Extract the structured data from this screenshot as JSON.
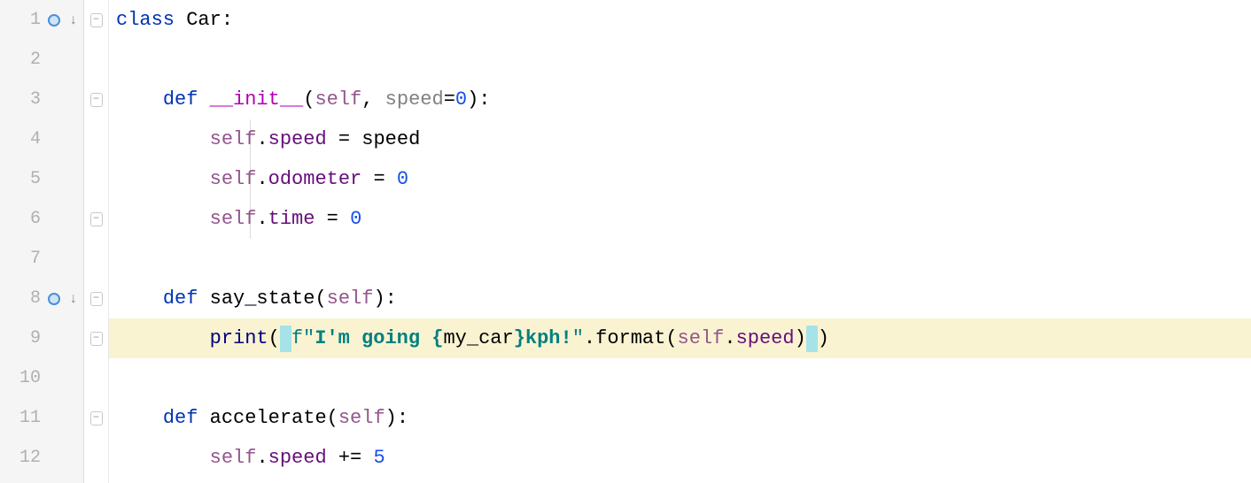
{
  "lines": [
    "1",
    "2",
    "3",
    "4",
    "5",
    "6",
    "7",
    "8",
    "9",
    "10",
    "11",
    "12"
  ],
  "code": {
    "l1": {
      "kw": "class",
      "name": "Car",
      "colon": ":"
    },
    "l3": {
      "kw": "def",
      "name": "__init__",
      "lp": "(",
      "self": "self",
      "comma": ", ",
      "param": "speed",
      "eq": "=",
      "default": "0",
      "rp": ")",
      "colon": ":"
    },
    "l4": {
      "self": "self",
      "dot": ".",
      "attr": "speed",
      "eq": " = ",
      "rhs": "speed"
    },
    "l5": {
      "self": "self",
      "dot": ".",
      "attr": "odometer",
      "eq": " = ",
      "rhs": "0"
    },
    "l6": {
      "self": "self",
      "dot": ".",
      "attr": "time",
      "eq": " = ",
      "rhs": "0"
    },
    "l8": {
      "kw": "def",
      "name": "say_state",
      "lp": "(",
      "self": "self",
      "rp": ")",
      "colon": ":"
    },
    "l9": {
      "builtin": "print",
      "lp": "(",
      "fpre": "f",
      "q1": "\"",
      "s1": "I'm going ",
      "lb": "{",
      "expr": "my_car",
      "rb": "}",
      "s2": "kph!",
      "q2": "\"",
      "dot": ".",
      "fmt": "format",
      "lp2": "(",
      "self": "self",
      "dot2": ".",
      "attr": "speed",
      "rp2": ")",
      "rp": ")"
    },
    "l11": {
      "kw": "def",
      "name": "accelerate",
      "lp": "(",
      "self": "self",
      "rp": ")",
      "colon": ":"
    },
    "l12": {
      "self": "self",
      "dot": ".",
      "attr": "speed",
      "op": " += ",
      "rhs": "5"
    }
  },
  "icons": {
    "override": "↓",
    "fold_open": "−"
  }
}
